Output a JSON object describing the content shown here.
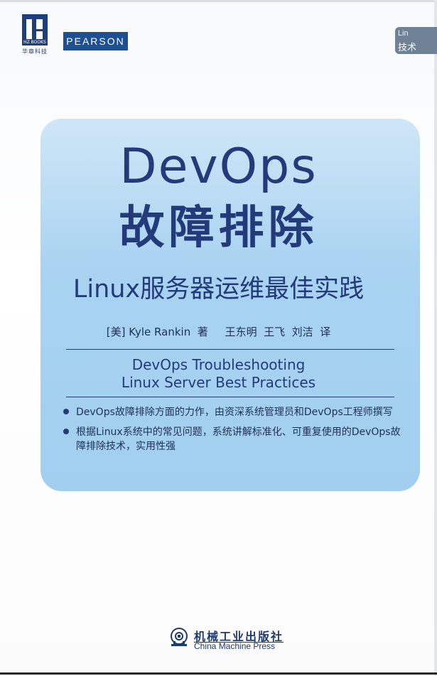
{
  "logos": {
    "hz_books_mark": "HZ BOOKS",
    "hz_books_cn": "华章科技",
    "pearson": "PEARSON",
    "series_tag_line1": "Lin",
    "series_tag_line2": "技术"
  },
  "book": {
    "title_en": "DevOps",
    "title_cn": "故障排除",
    "subtitle": "Linux服务器运维最佳实践",
    "authors": "[美] Kyle Rankin  著     王东明  王飞  刘洁  译",
    "english_title_line1": "DevOps Troubleshooting",
    "english_title_line2": "Linux Server Best Practices",
    "bullets": [
      "DevOps故障排除方面的力作，由资深系统管理员和DevOps工程师撰写",
      "根据Linux系统中的常见问题，系统讲解标准化、可重复使用的DevOps故障排除技术，实用性强"
    ]
  },
  "publisher": {
    "name_cn": "机械工业出版社",
    "name_en": "China Machine Press"
  },
  "colors": {
    "panel": "#a9d3f1",
    "title": "#233b7a",
    "pearson": "#1d4f93",
    "hz": "#1f3f7a"
  }
}
